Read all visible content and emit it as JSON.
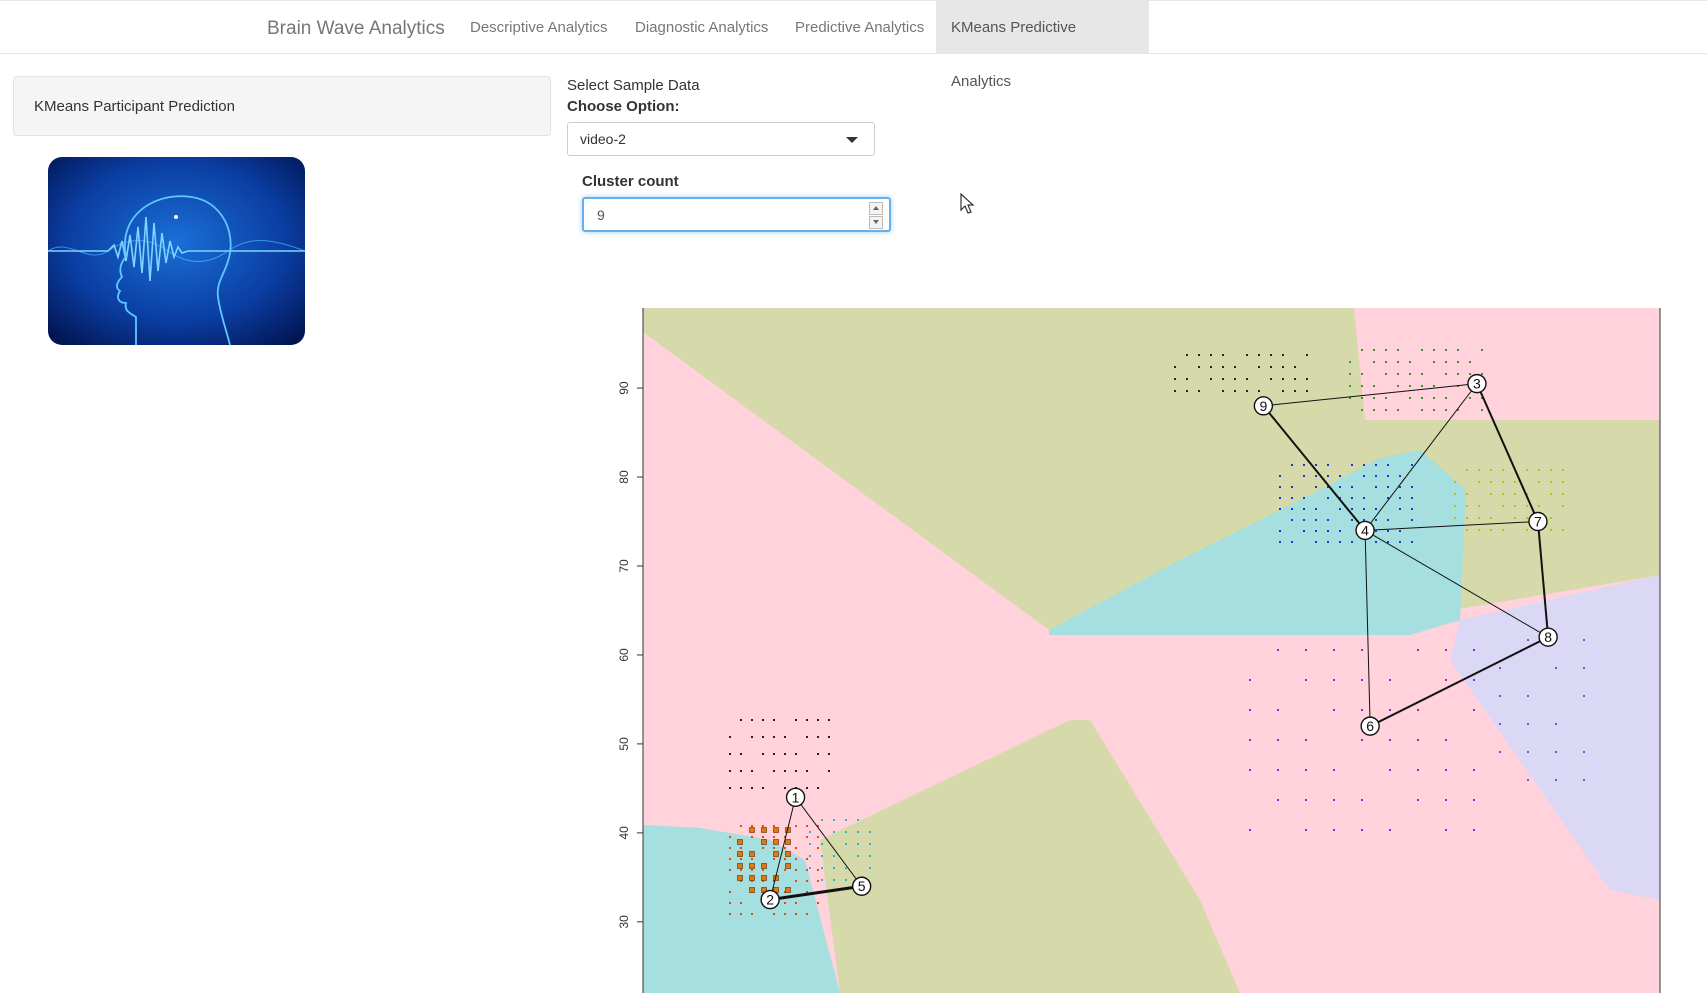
{
  "navbar": {
    "brand": "Brain Wave Analytics",
    "tabs": [
      {
        "label": "Descriptive Analytics",
        "active": false
      },
      {
        "label": "Diagnostic Analytics",
        "active": false
      },
      {
        "label": "Predictive Analytics",
        "active": false
      },
      {
        "label": "KMeans Predictive Analytics",
        "active": true
      }
    ]
  },
  "sidebar": {
    "panel_title": "KMeans Participant Prediction",
    "image_icon": "brain-wave-icon"
  },
  "main": {
    "sample_label": "Select Sample Data",
    "choose_label": "Choose Option:",
    "selected_option": "video-2",
    "cluster_label": "Cluster count",
    "cluster_value": "9"
  },
  "chart_data": {
    "type": "scatter",
    "title": "",
    "xlabel": "",
    "ylabel": "",
    "y_ticks": [
      "30",
      "40",
      "50",
      "60",
      "70",
      "80",
      "90"
    ],
    "x_range": [
      0,
      100
    ],
    "y_range": [
      22,
      99
    ],
    "region_colors": {
      "pink": "#ffd2dc",
      "olive": "#d6d9a9",
      "cyan": "#a5dfe0",
      "lavender": "#dad8f5"
    },
    "centers": [
      {
        "label": "1",
        "x": 15,
        "y": 44
      },
      {
        "label": "2",
        "x": 12.5,
        "y": 32.5
      },
      {
        "label": "3",
        "x": 82,
        "y": 90.5
      },
      {
        "label": "4",
        "x": 71,
        "y": 74
      },
      {
        "label": "5",
        "x": 21.5,
        "y": 34
      },
      {
        "label": "6",
        "x": 71.5,
        "y": 52
      },
      {
        "label": "7",
        "x": 88,
        "y": 75
      },
      {
        "label": "8",
        "x": 89,
        "y": 62
      },
      {
        "label": "9",
        "x": 61,
        "y": 88
      }
    ],
    "edges": [
      [
        "1",
        "2",
        1
      ],
      [
        "1",
        "5",
        1
      ],
      [
        "2",
        "5",
        3
      ],
      [
        "9",
        "3",
        1
      ],
      [
        "9",
        "4",
        2
      ],
      [
        "3",
        "4",
        1
      ],
      [
        "3",
        "7",
        2
      ],
      [
        "4",
        "7",
        1
      ],
      [
        "4",
        "8",
        1
      ],
      [
        "4",
        "6",
        1
      ],
      [
        "7",
        "8",
        2
      ],
      [
        "6",
        "8",
        2
      ]
    ]
  }
}
